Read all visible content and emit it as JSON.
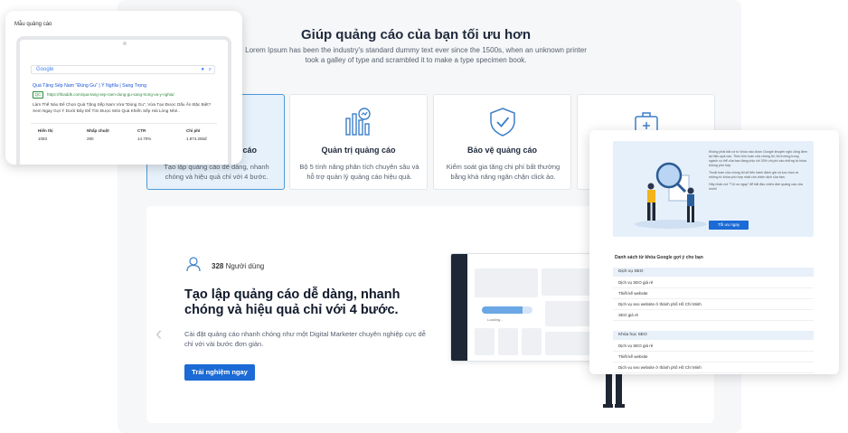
{
  "hero": {
    "title": "Giúp quảng cáo của bạn tối ưu hơn",
    "subtitle_line1": "Lorem Ipsum has been the industry's standard dummy text ever since the 1500s, when an unknown printer",
    "subtitle_line2": "took a galley of type and scrambled it to make a type specimen book."
  },
  "features": [
    {
      "title": "Tạo lập quảng cáo",
      "title_visible": "cáo",
      "desc": "Tạo lập quảng cáo dễ dàng, nhanh chóng và hiệu quả chỉ với 4 bước.",
      "icon": "create-ad-icon",
      "active": true
    },
    {
      "title": "Quản trị quảng cáo",
      "desc": "Bộ 5 tính năng phân tích chuyên sâu và hỗ trợ quản lý quảng cáo hiệu quả.",
      "icon": "analytics-icon"
    },
    {
      "title": "Bảo vệ quảng cáo",
      "desc": "Kiểm soát gia tăng chi phí bất thường bằng khả năng ngăn chặn click ảo.",
      "icon": "shield-check-icon"
    },
    {
      "title": "",
      "desc": "",
      "icon": "toolbox-icon"
    }
  ],
  "main": {
    "users_count": "328",
    "users_label": "Người dùng",
    "heading": "Tạo lập quảng cáo dễ dàng, nhanh chóng và hiệu quả chỉ với 4 bước.",
    "description": "Cài đặt quảng cáo nhanh chóng như một Digital Marketer chuyên nghiệp cực dễ chỉ với vài bước đơn giản.",
    "cta": "Trải nghiệm ngay",
    "prev_arrow": "‹",
    "mockup_loading": "Loading...",
    "mockup_progress": 0.8
  },
  "ad_preview": {
    "header": "Mẫu quảng cáo",
    "search_logo": "Google",
    "ad_title": "Quà Tặng Sếp Nam \"Đúng Gu\" | Ý Nghĩa | Sang Trọng",
    "ad_badge": "QC",
    "ad_url": "https://thiaddk.com/qua-tang-sep-nam-dung-gu-sang-trong-va-y-nghia/",
    "ad_text": "Làm Thế Nào Để Chọn Quà Tặng Sếp Nam Vừa \"Đúng Gu\", Vừa Tạo Được Dấu Ấn Đặc Biệt? Xem Ngay Gợi Ý Dưới Đây Để Tìm Được Món Quà Khiến Sếp Hài Lòng Nhé..",
    "stats": [
      {
        "label": "Hiển thị",
        "value": "1083"
      },
      {
        "label": "Nhấp chuột",
        "value": "280"
      },
      {
        "label": "CTR",
        "value": "14.70%"
      },
      {
        "label": "Chi phí",
        "value": "1.874.265đ"
      }
    ]
  },
  "seo": {
    "banner_p1": "Không phải bất cứ từ khóa nào được Google khuyến nghị cũng đem lại hiệu quả cao. Theo tính toán của chúng tôi, thị trường trong ngành cụ thể của bạn đang chịu chi 30% chi phí vào những từ khóa không phù hợp.",
    "banner_p2": "Thuật toán của chúng tôi sẽ tiến hành đánh giá và lựa chọn ra những từ khóa phù hợp nhất cho chiến dịch của bạn.",
    "banner_p3": "Hãy nhấn nút \"Tối ưu ngay\" để bắt đầu chiến dịch quảng cáo của mình!",
    "button": "Tối ưu ngay",
    "list_title": "Danh sách từ khóa Google gợi ý cho bạn",
    "groups": [
      {
        "name": "Dịch vụ SEO",
        "items": [
          "Dịch vụ SEO giá rẻ",
          "Thiết kế website",
          "Dịch vụ seo website ở thành phố Hồ Chí Minh",
          "SEO giá rẻ"
        ]
      },
      {
        "name": "Khóa học SEO",
        "items": [
          "Dịch vụ SEO giá rẻ",
          "Thiết kế website",
          "Dịch vụ seo website ở thành phố Hồ Chí Minh"
        ]
      }
    ]
  }
}
